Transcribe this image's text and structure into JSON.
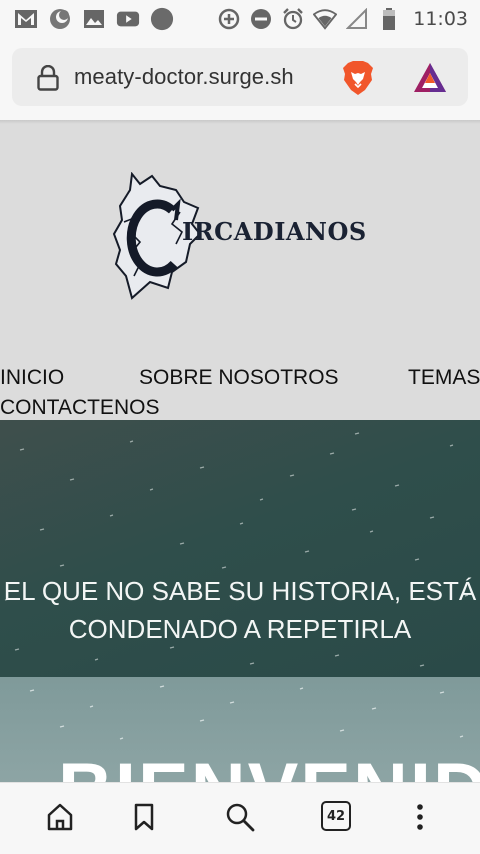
{
  "status_bar": {
    "time": "11:03",
    "left_icons": [
      "gmail-icon",
      "moon-icon",
      "image-icon",
      "youtube-icon",
      "circle-notification-icon"
    ],
    "right_icons": [
      "data-saver-icon",
      "do-not-disturb-icon",
      "alarm-icon",
      "wifi-icon",
      "signal-icon",
      "battery-icon"
    ]
  },
  "browser": {
    "url": "meaty-doctor.surge.sh",
    "brave_icon": "brave-lion-icon",
    "rewards_icon": "bat-triangle-icon",
    "tab_count": "42",
    "accent_brave": "#f1562b",
    "accent_bat": "#662d91"
  },
  "site": {
    "logo_text": "IRCADIANOS",
    "nav": {
      "inicio": "INICIO",
      "sobre": "SOBRE NOSOTROS",
      "temas": "TEMAS",
      "contacto": "CONTACTENOS"
    },
    "hero_line1": "EL QUE NO SABE SU HISTORIA, ESTÁ",
    "hero_line2": "CONDENADO A REPETIRLA",
    "welcome": "BIENVENIDO"
  },
  "bottom_nav": {
    "items": [
      "home-icon",
      "bookmark-icon",
      "search-icon",
      "tabs-icon",
      "more-icon"
    ]
  }
}
